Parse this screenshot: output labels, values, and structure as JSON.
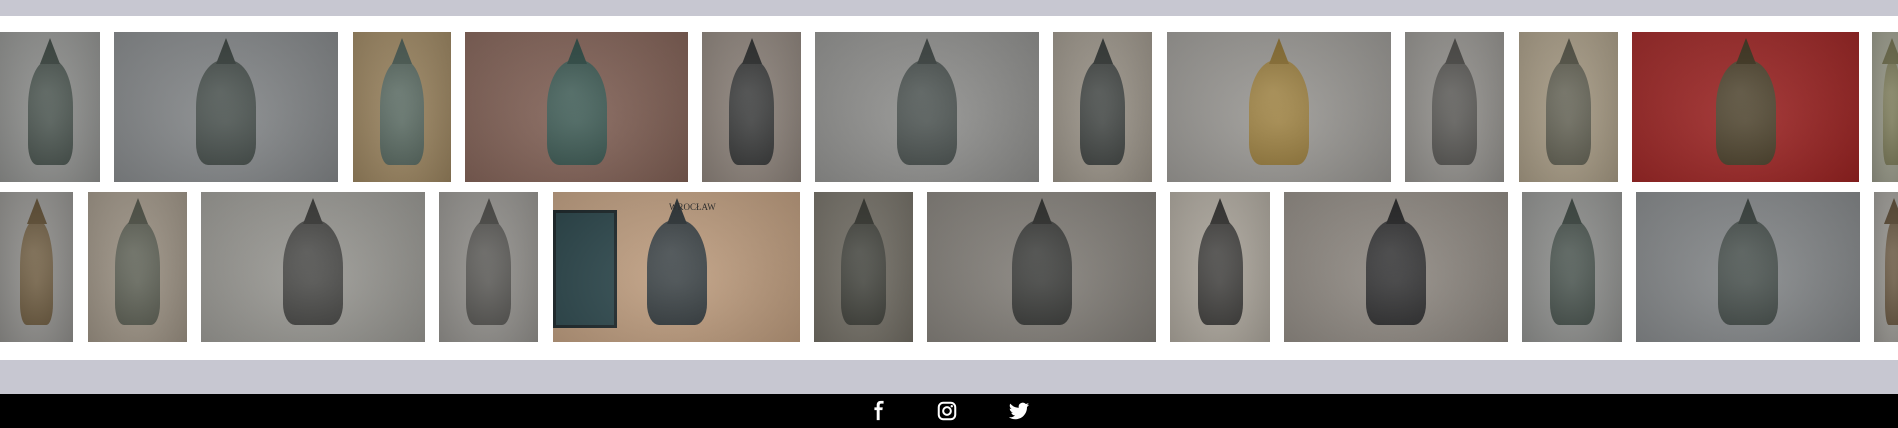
{
  "gallery": {
    "row1": [
      {
        "name": "gnome-figure-photo",
        "bg": "#9a9b99",
        "fg": "#3c4641"
      },
      {
        "name": "gnome-with-chain-photo",
        "bg": "#8f9294",
        "fg": "#39413e"
      },
      {
        "name": "gnome-on-cobblestone-photo",
        "bg": "#a48e6a",
        "fg": "#4a5a52"
      },
      {
        "name": "gnome-with-fishing-rod-photo",
        "bg": "#8c6c61",
        "fg": "#2f4b45"
      },
      {
        "name": "gnome-bust-photo",
        "bg": "#978d85",
        "fg": "#2d2e2e"
      },
      {
        "name": "gnome-on-motorbike-photo",
        "bg": "#9b9b99",
        "fg": "#3d4442"
      },
      {
        "name": "gnome-reading-photo",
        "bg": "#a59e93",
        "fg": "#343836"
      },
      {
        "name": "bronze-heart-photo",
        "bg": "#a5a39f",
        "fg": "#8b7033"
      },
      {
        "name": "gnome-on-bollard-photo",
        "bg": "#9e9c98",
        "fg": "#4b4a47"
      },
      {
        "name": "gnome-by-wall-photo",
        "bg": "#b1a58f",
        "fg": "#545346"
      },
      {
        "name": "gnome-on-horse-photo",
        "bg": "#a6302f",
        "fg": "#3f3520"
      },
      {
        "name": "gnome-edge-photo",
        "bg": "#9fa090",
        "fg": "#6b6a4a"
      }
    ],
    "row2": [
      {
        "name": "gnome-edge-left-photo",
        "bg": "#9b9a97",
        "fg": "#5f4e34"
      },
      {
        "name": "gnome-writing-photo",
        "bg": "#a79d8f",
        "fg": "#4f5247"
      },
      {
        "name": "gnome-at-desk-photo",
        "bg": "#a4a39e",
        "fg": "#3a3a38"
      },
      {
        "name": "gnome-on-bollard-2-photo",
        "bg": "#9e9c98",
        "fg": "#4b4a47"
      },
      {
        "name": "gnome-atm-photo",
        "bg": "#c9a88a",
        "fg": "#2d3437"
      },
      {
        "name": "gnome-sleeping-photo",
        "bg": "#7c786f",
        "fg": "#353630"
      },
      {
        "name": "gnomes-pushing-ball-photo",
        "bg": "#8e8a84",
        "fg": "#2e2f2d"
      },
      {
        "name": "gnome-scarf-photo",
        "bg": "#b7b1a7",
        "fg": "#343331"
      },
      {
        "name": "gnome-cyclist-photo",
        "bg": "#9a948d",
        "fg": "#252526"
      },
      {
        "name": "gnome-figure-2-photo",
        "bg": "#9a9b99",
        "fg": "#3c4641"
      },
      {
        "name": "gnome-with-chain-2-photo",
        "bg": "#8f9294",
        "fg": "#39413e"
      },
      {
        "name": "gnome-edge-right-photo",
        "bg": "#a3a19c",
        "fg": "#5a4a35"
      }
    ],
    "photo_text": {
      "wroclaw_sign": "WROCŁAW"
    }
  },
  "footer": {
    "social": [
      {
        "name": "facebook-icon"
      },
      {
        "name": "instagram-icon"
      },
      {
        "name": "twitter-icon"
      }
    ],
    "icon_color": "#ffffff",
    "background": "#000000"
  }
}
